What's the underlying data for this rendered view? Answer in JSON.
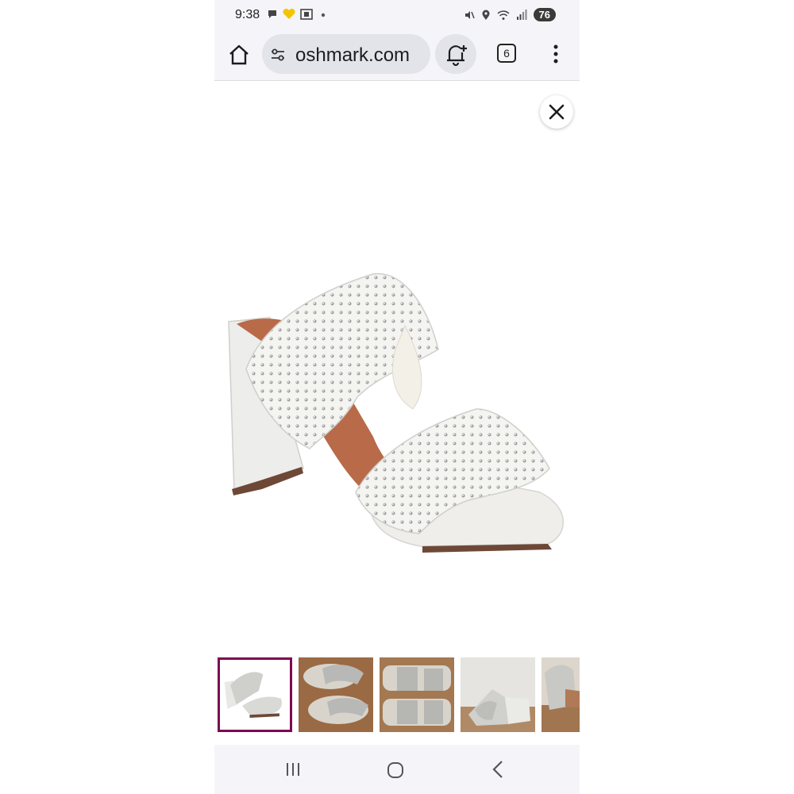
{
  "status_bar": {
    "time": "9:38",
    "battery": "76",
    "icons_left": [
      "chat-icon",
      "yellow-heart-icon",
      "screenshot-icon",
      "dot-icon"
    ],
    "icons_right": [
      "mute-icon",
      "location-icon",
      "wifi-icon",
      "signal-icon",
      "battery-icon"
    ]
  },
  "toolbar": {
    "url": "oshmark.com",
    "tab_count": "6",
    "icons": [
      "home-icon",
      "site-settings-icon",
      "notification-add-icon",
      "tabs-icon",
      "more-vert-icon"
    ]
  },
  "viewer": {
    "close_icon": "close-icon",
    "main_image": "white rhinestone ruffle block-heel sandal",
    "thumbnails": [
      {
        "label": "thumbnail 1",
        "selected": true
      },
      {
        "label": "thumbnail 2",
        "selected": false
      },
      {
        "label": "thumbnail 3",
        "selected": false
      },
      {
        "label": "thumbnail 4",
        "selected": false
      },
      {
        "label": "thumbnail 5",
        "selected": false
      }
    ]
  },
  "nav_bar": {
    "icons": [
      "recents-icon",
      "home-circle-icon",
      "back-icon"
    ]
  },
  "colors": {
    "chrome_bg": "#f5f5f9",
    "pill_bg": "#e3e3ea",
    "selected_border": "#7f0353"
  }
}
